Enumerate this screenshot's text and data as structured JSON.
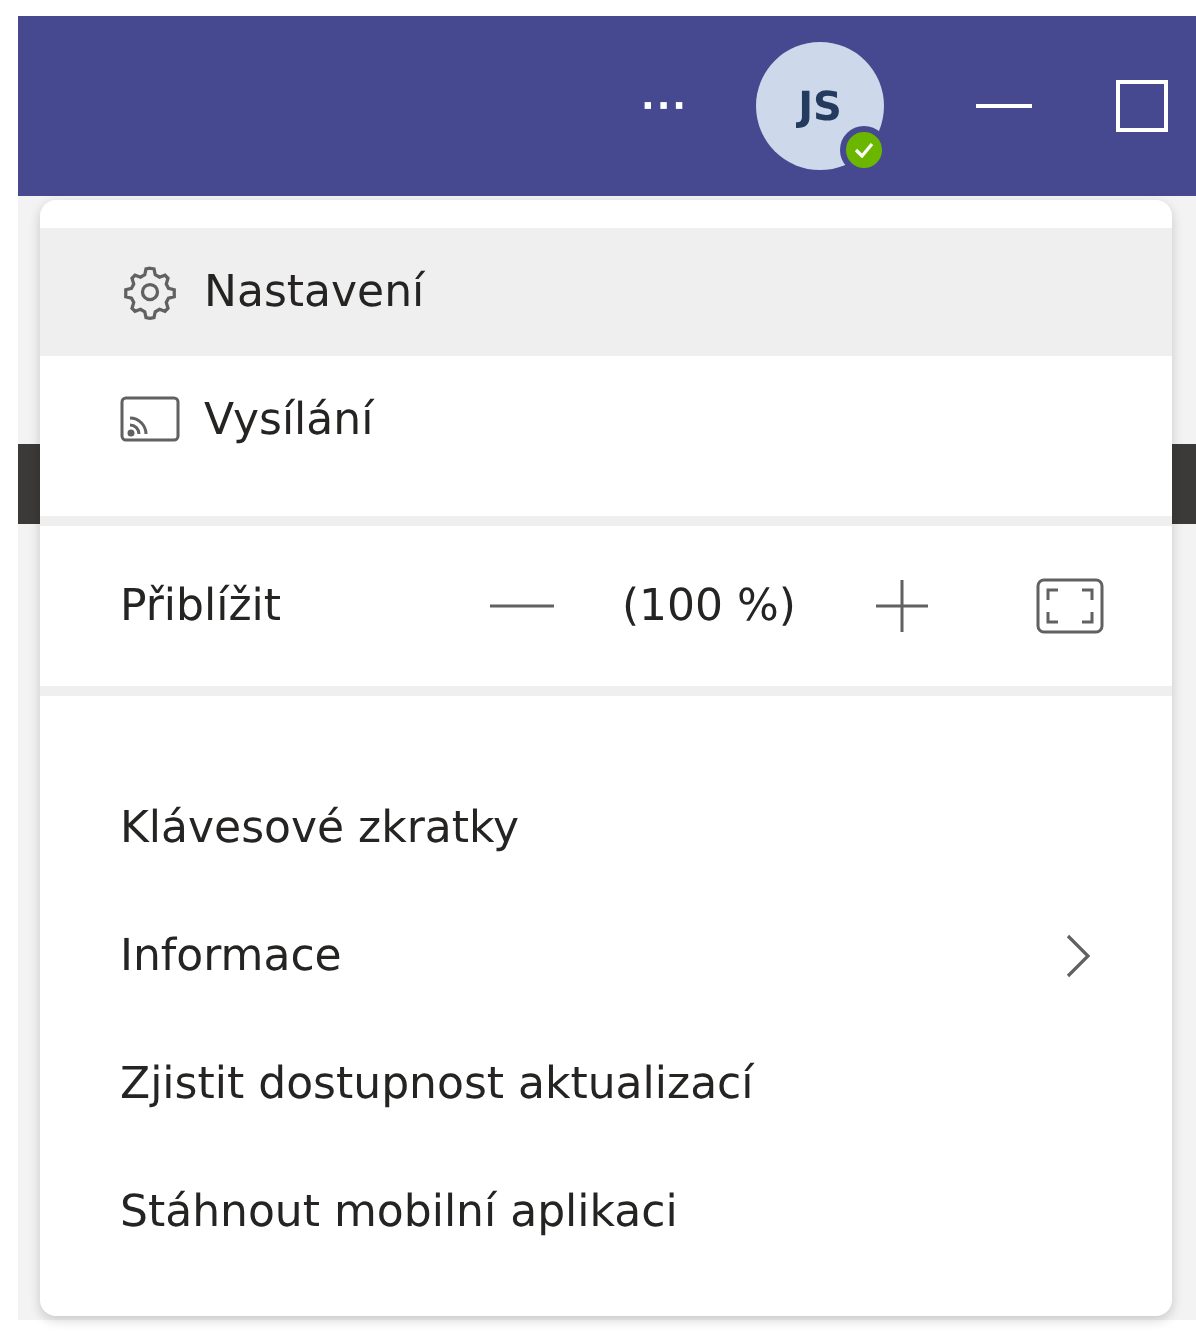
{
  "title_bar": {
    "more": "···",
    "avatar": {
      "initials": "JS"
    }
  },
  "menu": {
    "items": [
      {
        "kind": "settings",
        "label": "Nastavení",
        "selected": true
      },
      {
        "kind": "cast",
        "label": "Vysílání",
        "selected": false
      },
      {
        "kind": "zoom",
        "label": "Přiblížit",
        "value": "(100 %)"
      },
      {
        "kind": "text",
        "label": "Klávesové zkratky",
        "submenu": false
      },
      {
        "kind": "text",
        "label": "Informace",
        "submenu": true
      },
      {
        "kind": "text",
        "label": "Zjistit dostupnost aktualizací",
        "submenu": false
      },
      {
        "kind": "text",
        "label": "Stáhnout mobilní aplikaci",
        "submenu": false
      }
    ]
  }
}
